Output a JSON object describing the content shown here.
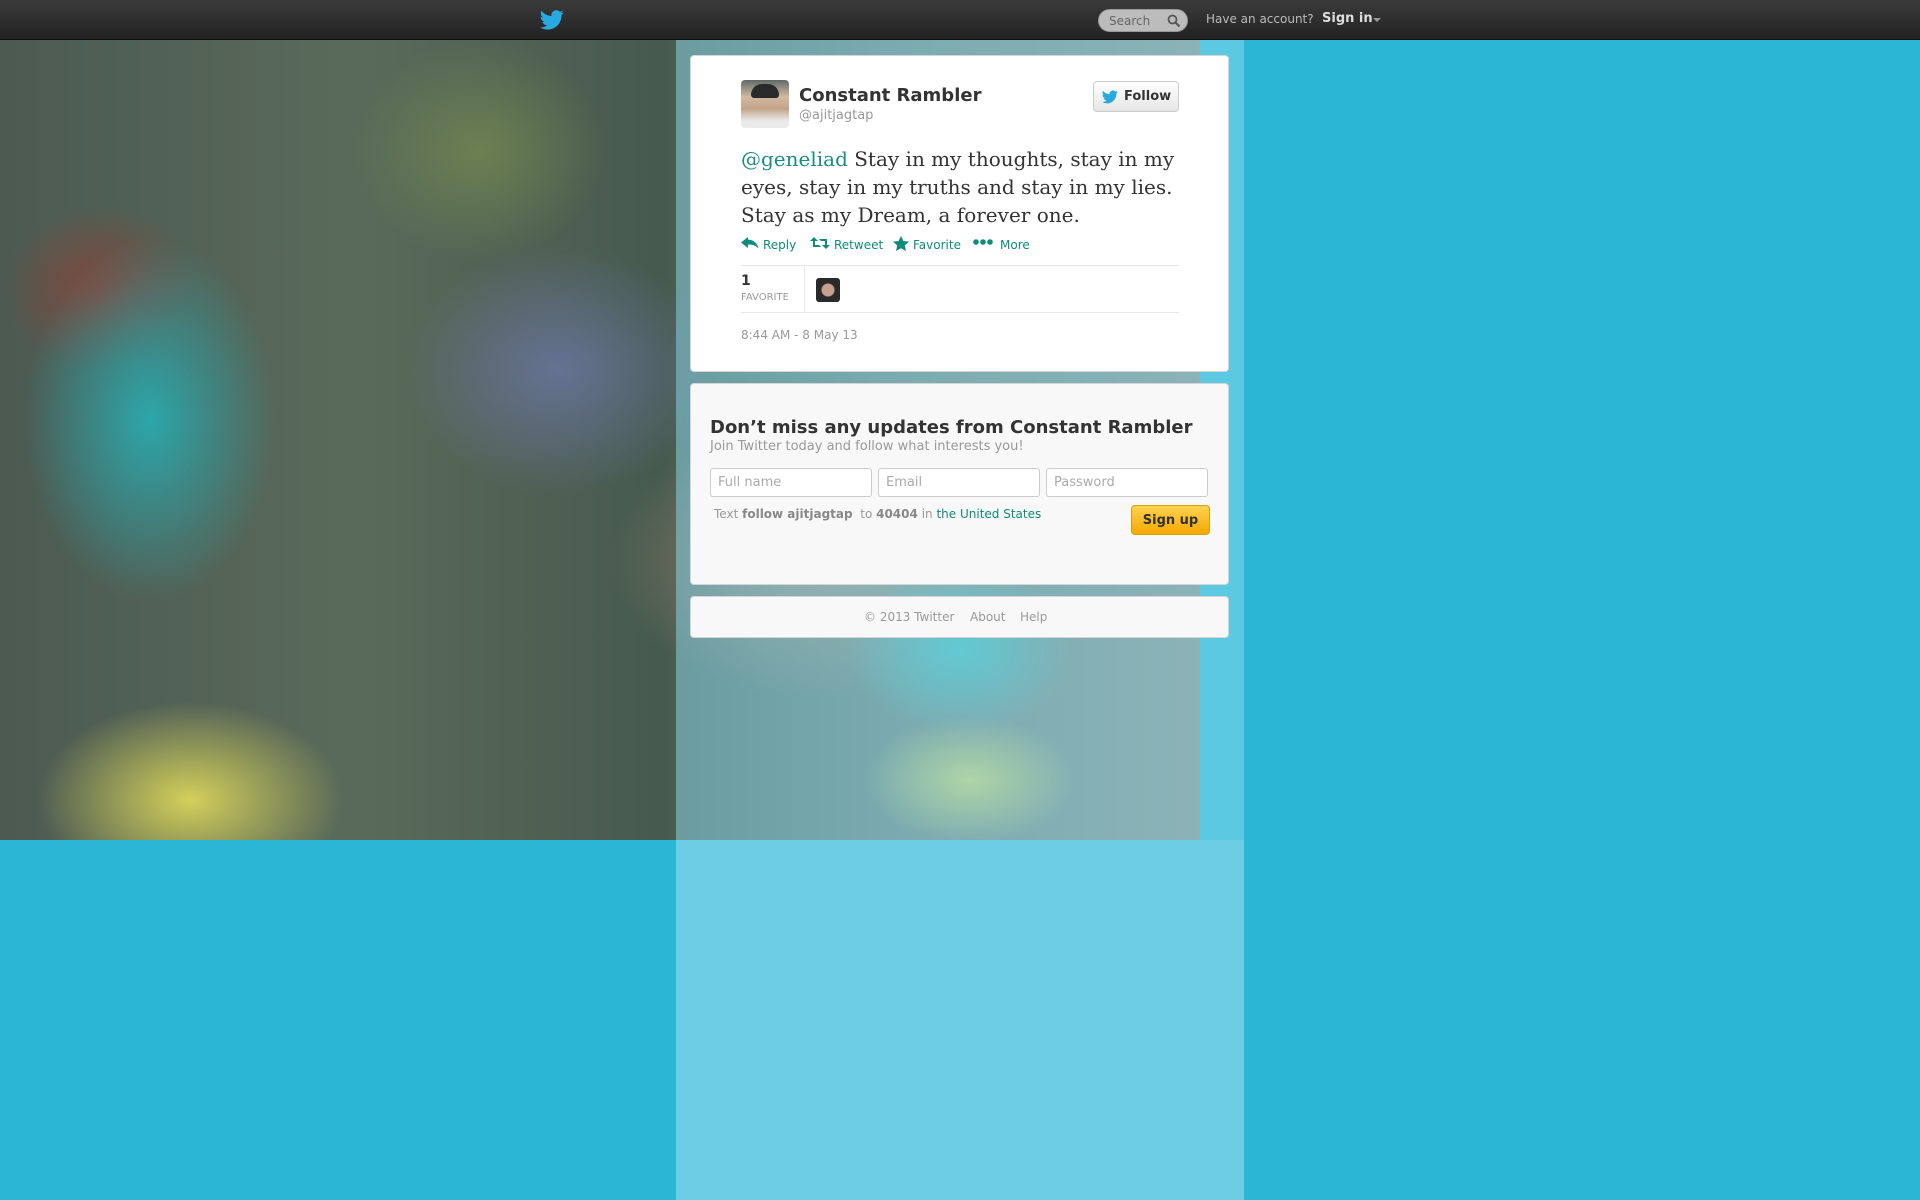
{
  "topbar": {
    "search_placeholder": "Search",
    "have_account": "Have an account?",
    "sign_in": "Sign in"
  },
  "tweet": {
    "display_name": "Constant Rambler",
    "screen_name": "@ajitjagtap",
    "follow_label": "Follow",
    "mention": "@geneliad",
    "text": " Stay in my thoughts, stay in my eyes, stay in my truths and stay in my lies. Stay as my Dream, a forever one.",
    "actions": {
      "reply": "Reply",
      "retweet": "Retweet",
      "favorite": "Favorite",
      "more": "More"
    },
    "stats": {
      "favorite_count": "1",
      "favorite_label": "FAVORITE"
    },
    "timestamp": "8:44 AM - 8 May 13"
  },
  "signup": {
    "title": "Don’t miss any updates from Constant Rambler",
    "subtitle": "Join Twitter today and follow what interests you!",
    "fullname_placeholder": "Full name",
    "email_placeholder": "Email",
    "password_placeholder": "Password",
    "sms_text": "Text",
    "sms_command": "follow ajitjagtap",
    "sms_to": "to",
    "sms_number": "40404",
    "sms_in": "in",
    "sms_country": "the United States",
    "signup_label": "Sign up"
  },
  "footer": {
    "copyright": "© 2013 Twitter",
    "about": "About",
    "help": "Help"
  },
  "colors": {
    "background": "#2cb6d6",
    "link": "#0f8b7a",
    "twitter_blue": "#2aa9e0",
    "signup_button": "#f5a800"
  }
}
